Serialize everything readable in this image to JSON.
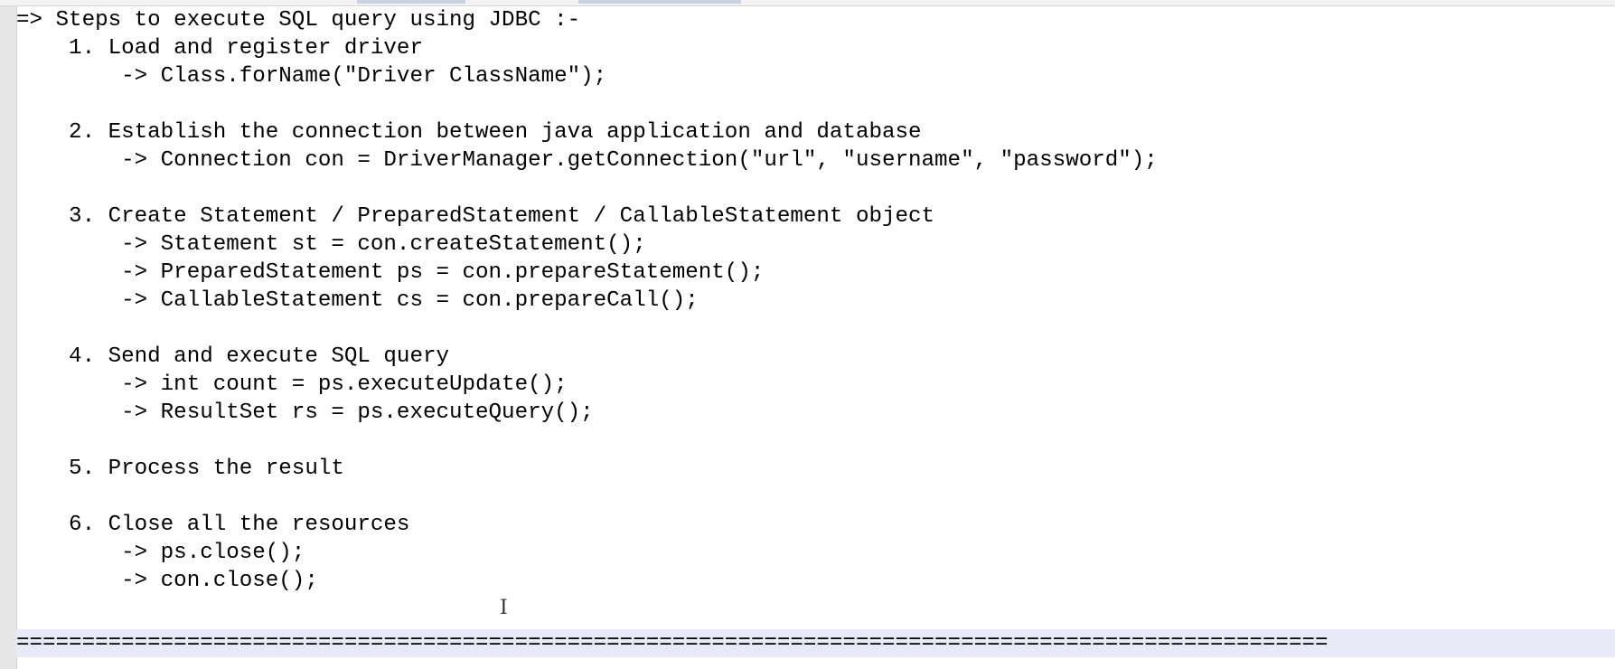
{
  "editor": {
    "lines": [
      "=> Steps to execute SQL query using JDBC :-",
      "    1. Load and register driver",
      "        -> Class.forName(\"Driver ClassName\");",
      "",
      "    2. Establish the connection between java application and database",
      "        -> Connection con = DriverManager.getConnection(\"url\", \"username\", \"password\");",
      "",
      "    3. Create Statement / PreparedStatement / CallableStatement object",
      "        -> Statement st = con.createStatement();",
      "        -> PreparedStatement ps = con.prepareStatement();",
      "        -> CallableStatement cs = con.prepareCall();",
      "",
      "    4. Send and execute SQL query",
      "        -> int count = ps.executeUpdate();",
      "        -> ResultSet rs = ps.executeQuery();",
      "",
      "    5. Process the result",
      "",
      "    6. Close all the resources",
      "        -> ps.close();",
      "        -> con.close();",
      "",
      "===================================================================================================="
    ],
    "current_line_index": 22,
    "colors": {
      "text": "#000000",
      "current_line_bg": "#e8eaf7",
      "gutter_bg": "#e6e6e6"
    }
  },
  "cursor": {
    "glyph": "I"
  }
}
